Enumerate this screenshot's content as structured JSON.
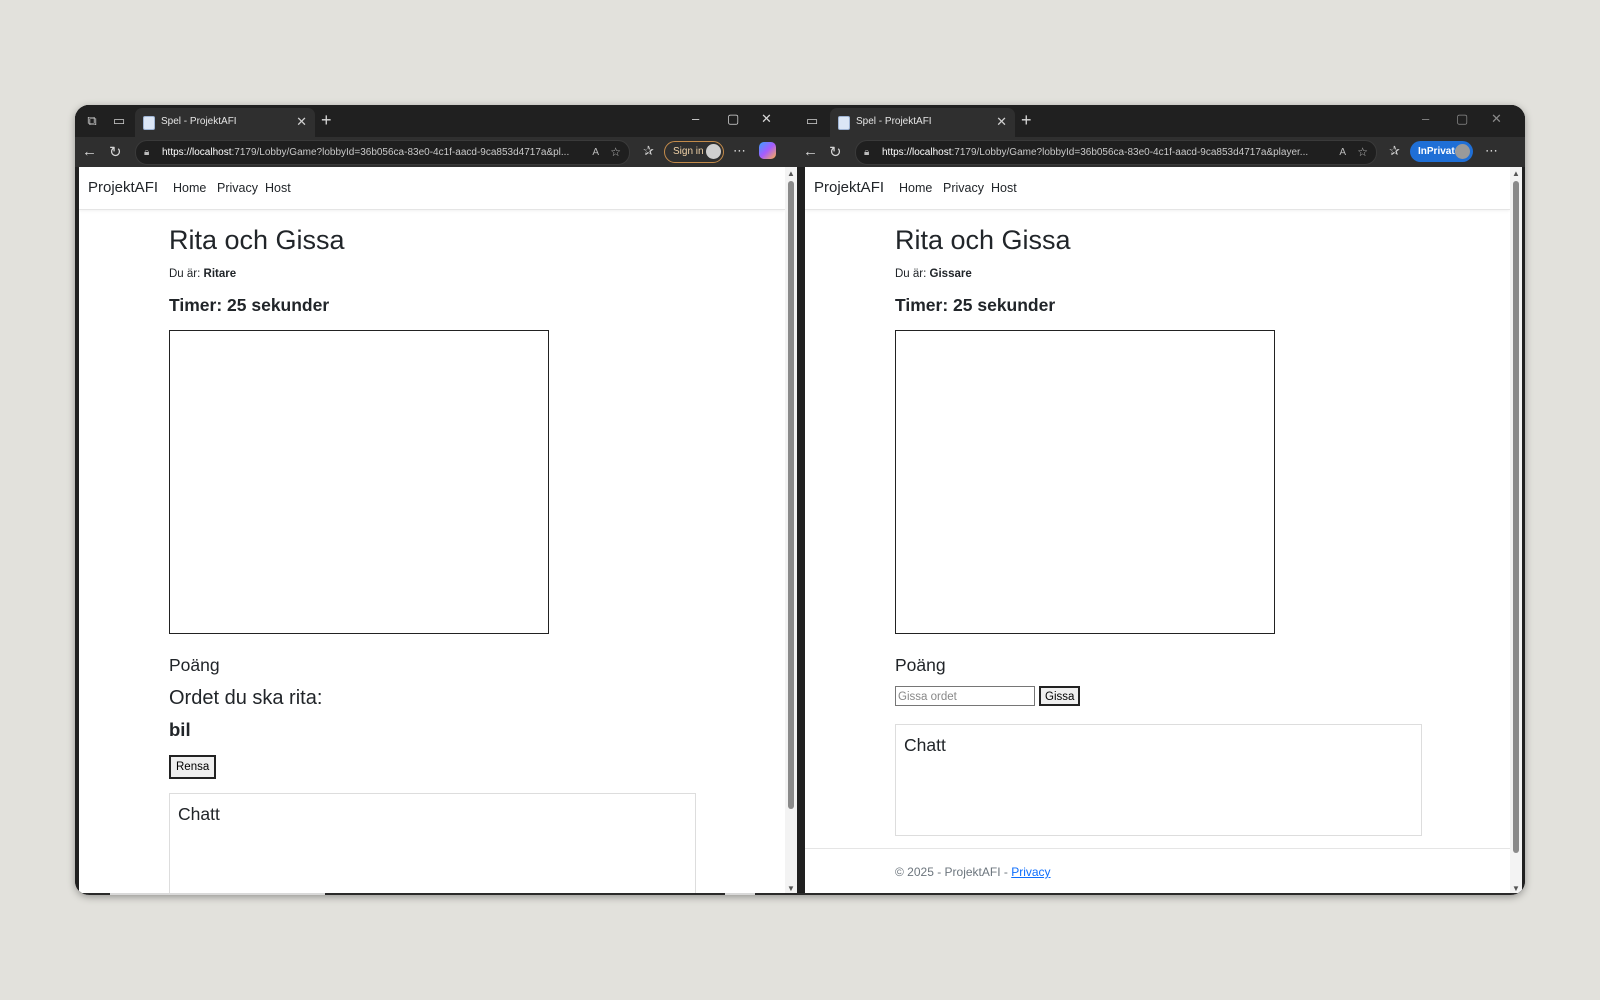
{
  "left_window": {
    "tab_title": "Spel - ProjektAFI",
    "url_host": "https://localhost",
    "url_rest": ":7179/Lobby/Game?lobbyId=36b056ca-83e0-4c1f-aacd-9ca853d4717a&pl...",
    "sign_in_label": "Sign in",
    "page": {
      "brand": "ProjektAFI",
      "nav": [
        "Home",
        "Privacy",
        "Host"
      ],
      "title": "Rita och Gissa",
      "role_prefix": "Du är:",
      "role": "Ritare",
      "timer": "Timer: 25 sekunder",
      "points_heading": "Poäng",
      "word_label": "Ordet du ska rita:",
      "word": "bil",
      "clear_label": "Rensa",
      "chat_title": "Chatt"
    }
  },
  "right_window": {
    "tab_title": "Spel - ProjektAFI",
    "url_host": "https://localhost",
    "url_rest": ":7179/Lobby/Game?lobbyId=36b056ca-83e0-4c1f-aacd-9ca853d4717a&player...",
    "inprivate_label": "InPrivate",
    "page": {
      "brand": "ProjektAFI",
      "nav": [
        "Home",
        "Privacy",
        "Host"
      ],
      "title": "Rita och Gissa",
      "role_prefix": "Du är:",
      "role": "Gissare",
      "timer": "Timer: 25 sekunder",
      "points_heading": "Poäng",
      "guess_placeholder": "Gissa ordet",
      "guess_label": "Gissa",
      "chat_title": "Chatt",
      "footer_text": "© 2025 - ProjektAFI - ",
      "footer_link": "Privacy"
    }
  },
  "icons": {
    "workspaces": "workspaces-icon",
    "tab_actions": "tab-actions-icon",
    "page_favicon": "page-icon",
    "close": "close-icon",
    "new_tab": "plus-icon",
    "minimize": "minimize-icon",
    "maximize": "maximize-icon",
    "back": "back-arrow-icon",
    "refresh": "refresh-icon",
    "lock": "lock-icon",
    "read_aloud": "read-aloud-icon",
    "favorite": "star-icon",
    "favorites": "favorites-icon",
    "more": "more-icon",
    "copilot": "copilot-icon"
  },
  "colors": {
    "desktop_bg": "#e2e1dc",
    "browser_chrome": "#202020",
    "inprivate_blue": "#1f6fd6",
    "link_blue": "#0d6efd"
  }
}
